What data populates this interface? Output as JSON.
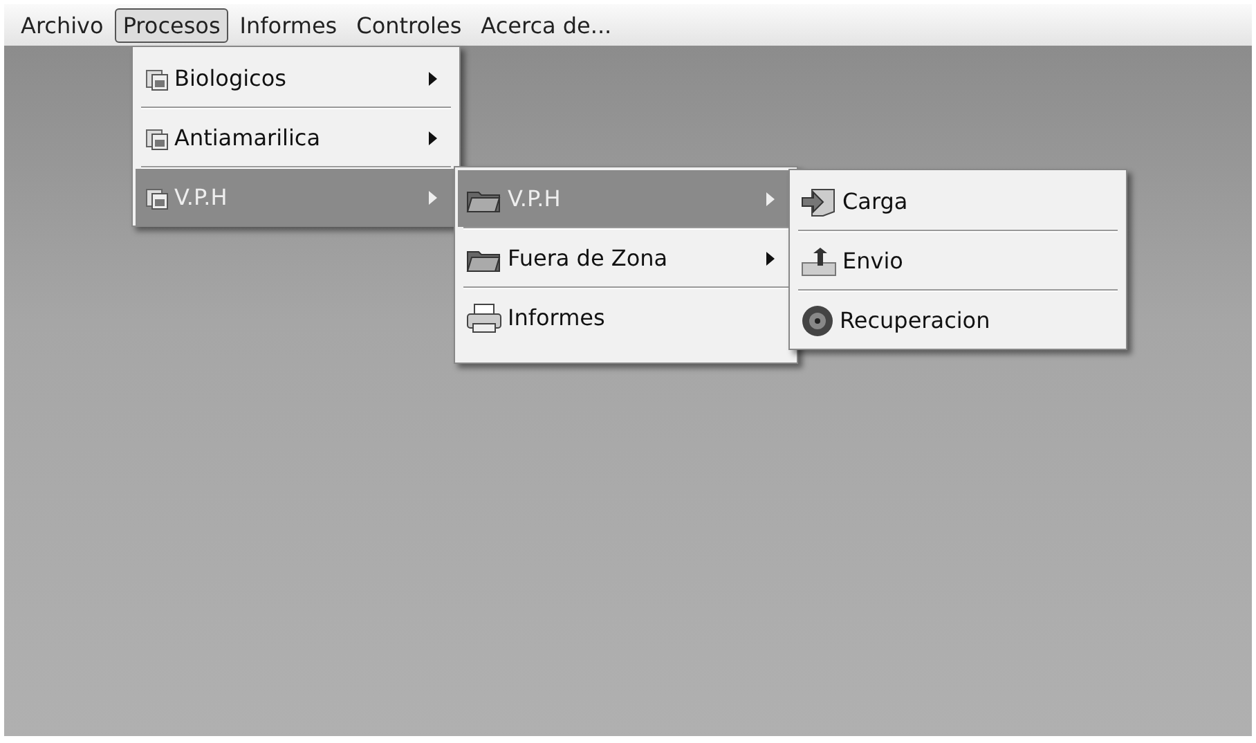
{
  "menu_bar": [
    {
      "label": "Archivo",
      "selected": false
    },
    {
      "label": "Procesos",
      "selected": true
    },
    {
      "label": "Informes",
      "selected": false
    },
    {
      "label": "Controles",
      "selected": false
    },
    {
      "label": "Acerca de...",
      "selected": false
    }
  ],
  "menus": [
    {
      "items": [
        {
          "label": "Biologicos",
          "kind": "calendar",
          "submenu": true,
          "selected": false
        },
        {
          "label": "Antiamarilica",
          "kind": "calendar",
          "submenu": true,
          "selected": false
        },
        {
          "label": "V.P.H",
          "kind": "calendar",
          "submenu": true,
          "selected": true
        }
      ]
    },
    {
      "items": [
        {
          "label": "V.P.H",
          "kind": "folder",
          "submenu": true,
          "selected": true
        },
        {
          "label": "Fuera de Zona",
          "kind": "folder",
          "submenu": true,
          "selected": false
        },
        {
          "label": "Informes",
          "kind": "printer",
          "submenu": false,
          "selected": false
        }
      ]
    },
    {
      "items": [
        {
          "label": "Carga",
          "kind": "import",
          "submenu": false,
          "selected": false
        },
        {
          "label": "Envio",
          "kind": "upload",
          "submenu": false,
          "selected": false
        },
        {
          "label": "Recuperacion",
          "kind": "disc",
          "submenu": false,
          "selected": false
        }
      ]
    }
  ]
}
